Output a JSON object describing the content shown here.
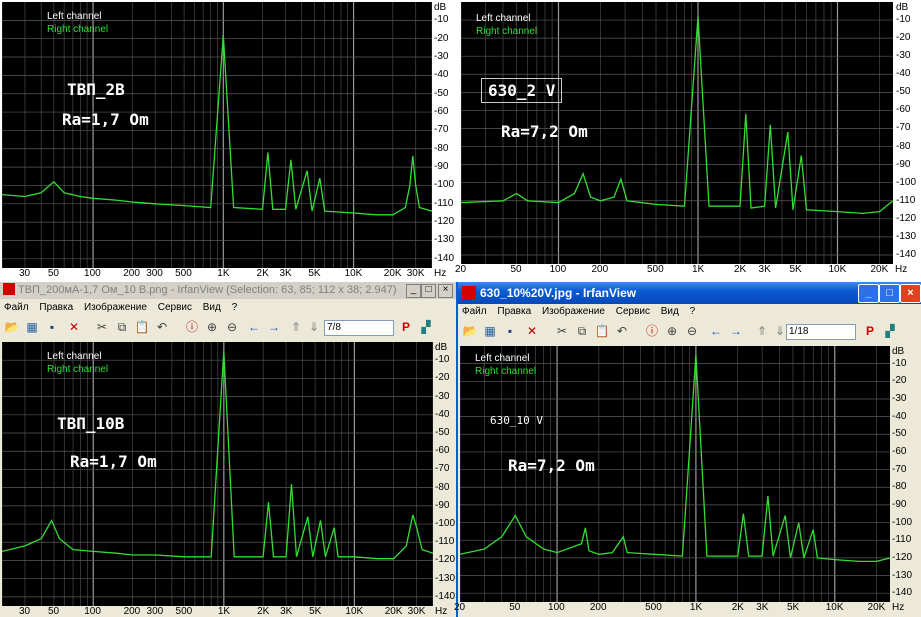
{
  "colors": {
    "accent_green": "#33dd33",
    "xp_blue": "#0a5bd6",
    "classic_titlebar": "#c0c0c0"
  },
  "db_ticks": [
    "dB",
    "-10",
    "-20",
    "-30",
    "-40",
    "-50",
    "-60",
    "-70",
    "-80",
    "-90",
    "-100",
    "-110",
    "-120",
    "-130",
    "-140"
  ],
  "panels": [
    {
      "id": "tl",
      "legend": {
        "left": "Left channel",
        "right": "Right channel"
      },
      "annotations": [
        "ТВП_2В",
        "Ra=1,7 Om"
      ],
      "x_ticks": [
        "30",
        "50",
        "100",
        "200",
        "300",
        "500",
        "1K",
        "2K",
        "3K",
        "5K",
        "10K",
        "20K",
        "30K",
        "Hz"
      ],
      "chart_data": {
        "type": "line",
        "x_scale": "log",
        "y_unit": "dB",
        "ylim": [
          -145,
          0
        ],
        "xlim": [
          20,
          40000
        ],
        "grid": true,
        "legend": "top-left",
        "series": [
          {
            "name": "Right channel",
            "points": [
              [
                20,
                -105
              ],
              [
                30,
                -106
              ],
              [
                40,
                -104
              ],
              [
                50,
                -98
              ],
              [
                60,
                -104
              ],
              [
                80,
                -106
              ],
              [
                100,
                -107
              ],
              [
                150,
                -108
              ],
              [
                200,
                -109
              ],
              [
                300,
                -110
              ],
              [
                500,
                -111
              ],
              [
                800,
                -112
              ],
              [
                1000,
                -18
              ],
              [
                1200,
                -112
              ],
              [
                2000,
                -113
              ],
              [
                2200,
                -82
              ],
              [
                2400,
                -113
              ],
              [
                3000,
                -113
              ],
              [
                3300,
                -86
              ],
              [
                3600,
                -113
              ],
              [
                4400,
                -92
              ],
              [
                4800,
                -114
              ],
              [
                5500,
                -96
              ],
              [
                6000,
                -114
              ],
              [
                10000,
                -115
              ],
              [
                15000,
                -116
              ],
              [
                20000,
                -116
              ],
              [
                25000,
                -112
              ],
              [
                27000,
                -100
              ],
              [
                28500,
                -84
              ],
              [
                30000,
                -100
              ],
              [
                32000,
                -112
              ],
              [
                40000,
                -114
              ]
            ]
          }
        ]
      },
      "window": null
    },
    {
      "id": "tr",
      "legend": {
        "left": "Left channel",
        "right": "Right channel"
      },
      "annotations": [
        "630_2 V",
        "Ra=7,2 Om"
      ],
      "x_ticks": [
        "20",
        "50",
        "100",
        "200",
        "500",
        "1K",
        "2K",
        "3K",
        "5K",
        "10K",
        "20K",
        "Hz"
      ],
      "chart_data": {
        "type": "line",
        "x_scale": "log",
        "y_unit": "dB",
        "ylim": [
          -145,
          0
        ],
        "xlim": [
          20,
          25000
        ],
        "grid": true,
        "legend": "top-left",
        "series": [
          {
            "name": "Right channel",
            "points": [
              [
                20,
                -111
              ],
              [
                40,
                -110
              ],
              [
                50,
                -106
              ],
              [
                60,
                -110
              ],
              [
                100,
                -111
              ],
              [
                130,
                -106
              ],
              [
                150,
                -95
              ],
              [
                170,
                -108
              ],
              [
                200,
                -110
              ],
              [
                250,
                -108
              ],
              [
                280,
                -98
              ],
              [
                310,
                -110
              ],
              [
                500,
                -112
              ],
              [
                800,
                -113
              ],
              [
                1000,
                -8
              ],
              [
                1200,
                -113
              ],
              [
                2000,
                -113
              ],
              [
                2200,
                -62
              ],
              [
                2400,
                -114
              ],
              [
                3000,
                -113
              ],
              [
                3300,
                -68
              ],
              [
                3600,
                -114
              ],
              [
                4400,
                -72
              ],
              [
                4800,
                -115
              ],
              [
                5500,
                -85
              ],
              [
                6000,
                -115
              ],
              [
                10000,
                -116
              ],
              [
                15000,
                -117
              ],
              [
                20000,
                -116
              ],
              [
                25000,
                -110
              ]
            ]
          }
        ]
      },
      "window": null
    },
    {
      "id": "bl",
      "legend": {
        "left": "Left channel",
        "right": "Right channel"
      },
      "annotations": [
        "ТВП_10В",
        "Ra=1,7 Om"
      ],
      "x_ticks": [
        "30",
        "50",
        "100",
        "200",
        "300",
        "500",
        "1K",
        "2K",
        "3K",
        "5K",
        "10K",
        "20K",
        "30K",
        "Hz"
      ],
      "chart_data": {
        "type": "line",
        "x_scale": "log",
        "y_unit": "dB",
        "ylim": [
          -145,
          0
        ],
        "xlim": [
          20,
          40000
        ],
        "grid": true,
        "legend": "top-left",
        "series": [
          {
            "name": "Right channel",
            "points": [
              [
                20,
                -115
              ],
              [
                30,
                -112
              ],
              [
                40,
                -108
              ],
              [
                48,
                -98
              ],
              [
                55,
                -108
              ],
              [
                70,
                -114
              ],
              [
                100,
                -115
              ],
              [
                150,
                -116
              ],
              [
                200,
                -117
              ],
              [
                300,
                -117
              ],
              [
                500,
                -118
              ],
              [
                800,
                -118
              ],
              [
                1000,
                -5
              ],
              [
                1200,
                -118
              ],
              [
                2000,
                -118
              ],
              [
                2200,
                -88
              ],
              [
                2400,
                -118
              ],
              [
                3000,
                -118
              ],
              [
                3300,
                -78
              ],
              [
                3600,
                -118
              ],
              [
                4400,
                -96
              ],
              [
                4800,
                -118
              ],
              [
                5500,
                -98
              ],
              [
                6000,
                -118
              ],
              [
                7000,
                -102
              ],
              [
                7500,
                -118
              ],
              [
                10000,
                -118
              ],
              [
                15000,
                -119
              ],
              [
                20000,
                -119
              ],
              [
                25000,
                -112
              ],
              [
                28000,
                -95
              ],
              [
                30000,
                -102
              ],
              [
                33000,
                -114
              ],
              [
                40000,
                -116
              ]
            ]
          }
        ]
      },
      "window": {
        "title": "ТВП_200мА-1,7 Ом_10 В.png - IrfanView (Selection: 63, 85; 112 x 38; 2.947)",
        "style": "classic",
        "menu": [
          "Файл",
          "Правка",
          "Изображение",
          "Сервис",
          "Вид",
          "?"
        ],
        "page": "7/8"
      }
    },
    {
      "id": "br",
      "legend": {
        "left": "Left channel",
        "right": "Right channel"
      },
      "annotations": [
        "630_10 V",
        "Ra=7,2 Om"
      ],
      "x_ticks": [
        "20",
        "50",
        "100",
        "200",
        "500",
        "1K",
        "2K",
        "3K",
        "5K",
        "10K",
        "20K",
        "Hz"
      ],
      "chart_data": {
        "type": "line",
        "x_scale": "log",
        "y_unit": "dB",
        "ylim": [
          -145,
          0
        ],
        "xlim": [
          20,
          25000
        ],
        "grid": true,
        "legend": "top-left",
        "series": [
          {
            "name": "Right channel",
            "points": [
              [
                20,
                -118
              ],
              [
                30,
                -115
              ],
              [
                40,
                -108
              ],
              [
                50,
                -96
              ],
              [
                60,
                -108
              ],
              [
                80,
                -115
              ],
              [
                100,
                -117
              ],
              [
                150,
                -112
              ],
              [
                160,
                -103
              ],
              [
                170,
                -116
              ],
              [
                200,
                -118
              ],
              [
                250,
                -117
              ],
              [
                300,
                -108
              ],
              [
                320,
                -117
              ],
              [
                500,
                -118
              ],
              [
                800,
                -119
              ],
              [
                1000,
                -5
              ],
              [
                1200,
                -119
              ],
              [
                2000,
                -119
              ],
              [
                2200,
                -95
              ],
              [
                2400,
                -119
              ],
              [
                3000,
                -119
              ],
              [
                3300,
                -85
              ],
              [
                3600,
                -119
              ],
              [
                4400,
                -96
              ],
              [
                4800,
                -120
              ],
              [
                5500,
                -100
              ],
              [
                6000,
                -120
              ],
              [
                7000,
                -104
              ],
              [
                7500,
                -120
              ],
              [
                10000,
                -121
              ],
              [
                15000,
                -122
              ],
              [
                20000,
                -122
              ],
              [
                25000,
                -120
              ]
            ]
          }
        ]
      },
      "window": {
        "title": "630_10%20V.jpg - IrfanView",
        "style": "xp",
        "menu": [
          "Файл",
          "Правка",
          "Изображение",
          "Сервис",
          "Вид",
          "?"
        ],
        "page": "1/18"
      }
    }
  ]
}
